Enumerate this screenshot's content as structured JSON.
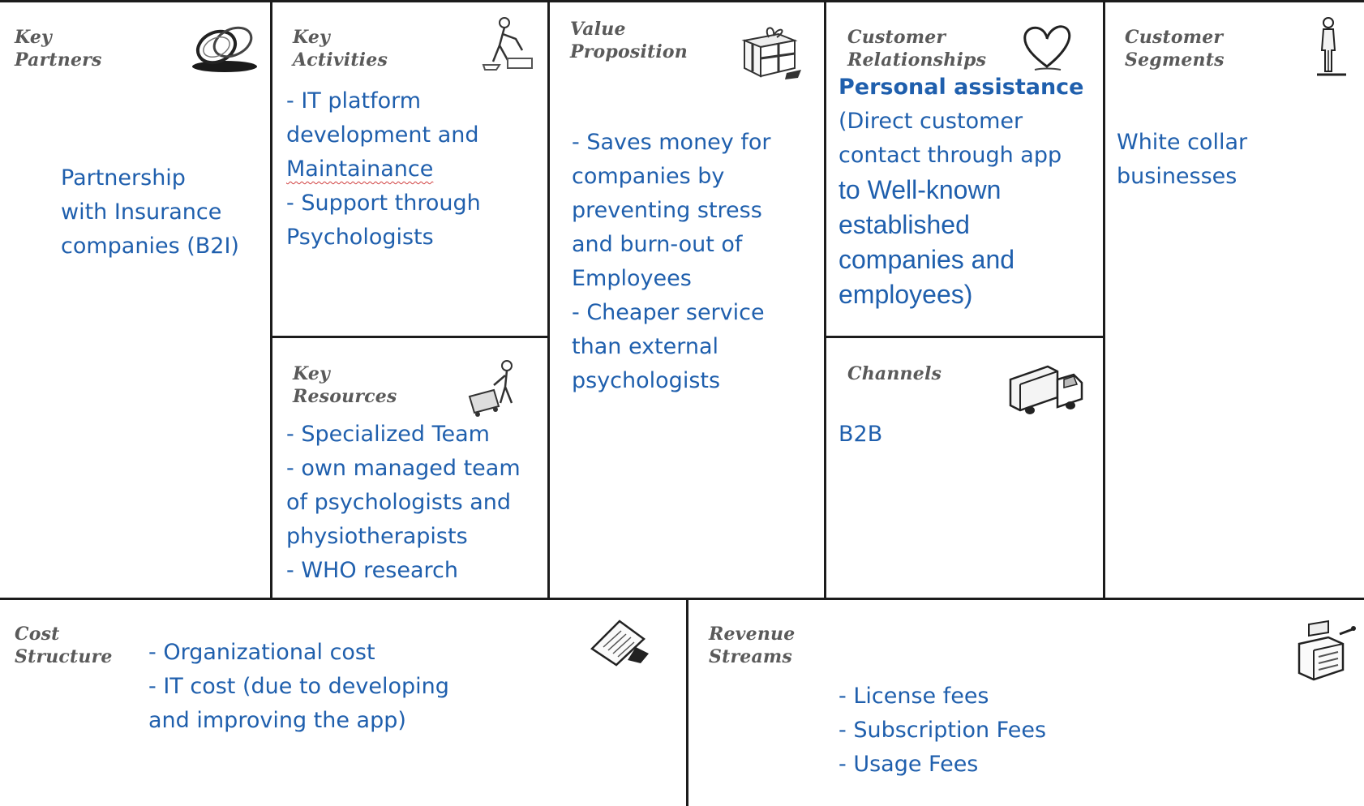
{
  "sections": {
    "key_partners": {
      "label_lines": [
        "Key",
        "Partners"
      ],
      "icon": "chain-links-icon",
      "lines": [
        "Partnership",
        "with Insurance",
        "companies (B2I)"
      ]
    },
    "key_activities": {
      "label_lines": [
        "Key",
        "Activities"
      ],
      "icon": "worker-icon",
      "lines": [
        "- IT platform",
        "development and",
        "Maintainance",
        "- Support through",
        "Psychologists"
      ]
    },
    "key_resources": {
      "label_lines": [
        "Key",
        "Resources"
      ],
      "icon": "person-with-cart-icon",
      "lines": [
        "- Specialized Team",
        "- own managed team",
        "of psychologists and",
        "physiotherapists",
        "- WHO research"
      ]
    },
    "value_proposition": {
      "label_lines": [
        "Value",
        "Proposition"
      ],
      "icon": "gift-box-icon",
      "lines": [
        "- Saves money for",
        "companies by",
        "preventing stress",
        "and burn-out of",
        "Employees",
        "- Cheaper service",
        "than external",
        "psychologists"
      ]
    },
    "customer_relationships": {
      "label_lines": [
        "Customer",
        "Relationships"
      ],
      "icon": "heart-icon",
      "heading": "Personal assistance",
      "lines": [
        "(Direct customer",
        "contact through app"
      ],
      "big_lines": [
        "to Well-known",
        "established",
        "companies and",
        "employees)"
      ]
    },
    "channels": {
      "label_lines": [
        "Channels"
      ],
      "icon": "delivery-truck-icon",
      "lines": [
        "B2B"
      ]
    },
    "customer_segments": {
      "label_lines": [
        "Customer",
        "Segments"
      ],
      "icon": "standing-person-icon",
      "lines": [
        "White collar",
        "businesses"
      ]
    },
    "cost_structure": {
      "label_lines": [
        "Cost",
        "Structure"
      ],
      "icon": "receipt-icon",
      "lines": [
        "- Organizational cost",
        "- IT cost (due to  developing",
        "and improving the app)"
      ]
    },
    "revenue_streams": {
      "label_lines": [
        "Revenue",
        "Streams"
      ],
      "icon": "cash-register-icon",
      "lines": [
        "- License fees",
        "- Subscription Fees",
        "- Usage Fees"
      ]
    }
  }
}
